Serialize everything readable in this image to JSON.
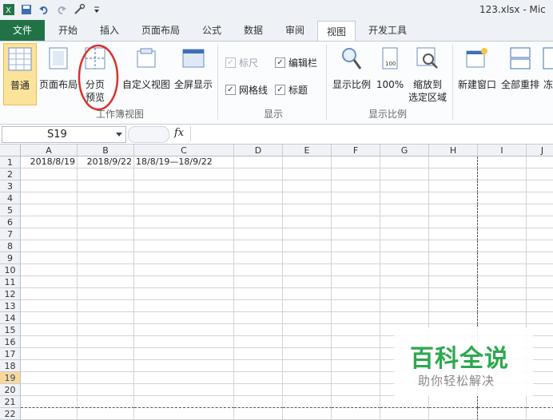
{
  "window": {
    "title": "123.xlsx  -  Mic"
  },
  "qat": {
    "icons": [
      "excel-logo-icon",
      "save-icon",
      "undo-icon",
      "redo-icon",
      "tools-icon",
      "customize-icon"
    ]
  },
  "tabs": [
    "文件",
    "开始",
    "插入",
    "页面布局",
    "公式",
    "数据",
    "审阅",
    "视图",
    "开发工具"
  ],
  "ribbon": {
    "workbook_views": {
      "label": "工作簿视图",
      "buttons": [
        "普通",
        "页面布局",
        "分页",
        "预览",
        "自定义视图",
        "全屏显示"
      ]
    },
    "show": {
      "label": "显示",
      "ruler": "标尺",
      "formula_bar": "编辑栏",
      "gridlines": "网格线",
      "headings": "标题"
    },
    "zoom": {
      "label": "显示比例",
      "zoom": "显示比例",
      "hundred": "100%",
      "fit1": "缩放到",
      "fit2": "选定区域"
    },
    "window": {
      "new_window": "新建窗口",
      "arrange_all": "全部重排",
      "freeze": "冻"
    }
  },
  "formula_bar": {
    "name_box": "S19",
    "fx": "fx"
  },
  "sheet": {
    "columns": [
      "A",
      "B",
      "C",
      "D",
      "E",
      "F",
      "G",
      "H",
      "I",
      "J"
    ],
    "rows": [
      "1",
      "2",
      "3",
      "4",
      "5",
      "6",
      "7",
      "8",
      "9",
      "10",
      "11",
      "12",
      "13",
      "14",
      "15",
      "16",
      "17",
      "18",
      "19",
      "20",
      "21",
      "22"
    ],
    "cells": {
      "A1": "2018/8/19",
      "B1": "2018/9/22",
      "C1": "18/8/19—18/9/22"
    },
    "active_row": "19"
  },
  "watermark": {
    "line1": "百科全说",
    "line2": "助你轻松解决"
  }
}
